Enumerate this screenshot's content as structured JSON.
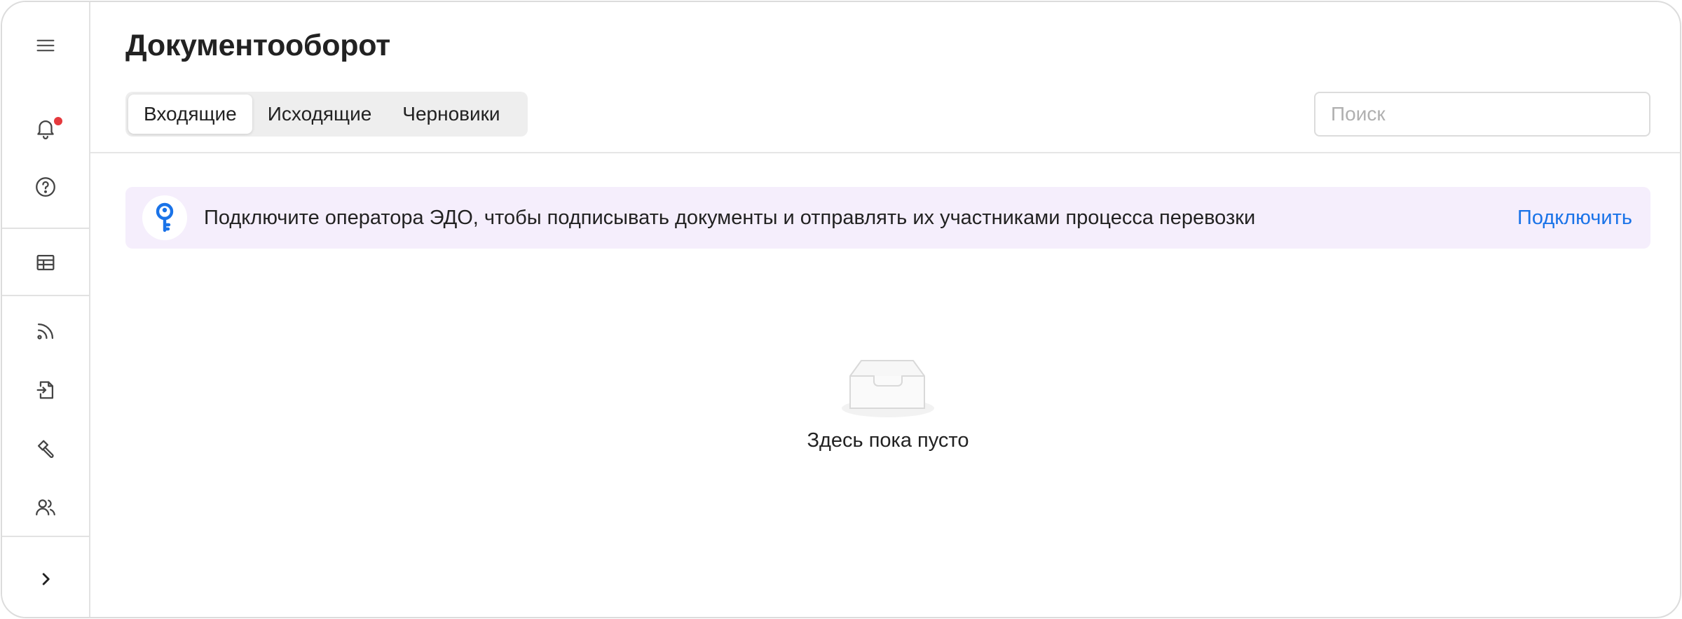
{
  "sidebar": {
    "items": [
      {
        "icon": "menu-icon"
      },
      {
        "icon": "bell-icon",
        "badge_color": "#e5393d"
      },
      {
        "icon": "help-circle-icon"
      },
      {
        "icon": "table-icon"
      },
      {
        "icon": "rss-feed-icon"
      },
      {
        "icon": "document-sign-icon"
      },
      {
        "icon": "hammer-icon"
      },
      {
        "icon": "users-icon"
      },
      {
        "icon": "chevron-right-icon"
      }
    ]
  },
  "header": {
    "title": "Документооборот"
  },
  "tabs": [
    {
      "label": "Входящие",
      "active": true
    },
    {
      "label": "Исходящие",
      "active": false
    },
    {
      "label": "Черновики",
      "active": false
    }
  ],
  "search": {
    "placeholder": "Поиск",
    "value": ""
  },
  "banner": {
    "icon": "key-icon",
    "text": "Подключите оператора ЭДО, чтобы подписывать документы и отправлять их участниками процесса перевозки",
    "action_label": "Подключить",
    "background": "#f5eefc",
    "accent": "#1a73e8"
  },
  "empty_state": {
    "icon": "empty-inbox-icon",
    "text": "Здесь пока пусто"
  }
}
